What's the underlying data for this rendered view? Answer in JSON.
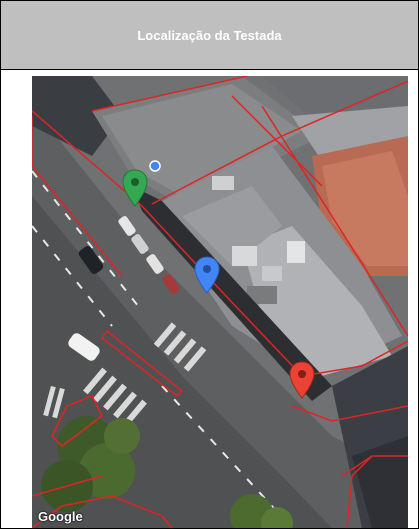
{
  "header": {
    "title": "Localização da Testada"
  },
  "map": {
    "attribution": "Google",
    "markers": [
      {
        "name": "green-marker",
        "color": "#34a853"
      },
      {
        "name": "blue-marker",
        "color": "#4285f4"
      },
      {
        "name": "red-marker",
        "color": "#ea4335"
      }
    ],
    "boundary_color": "#e02424"
  }
}
